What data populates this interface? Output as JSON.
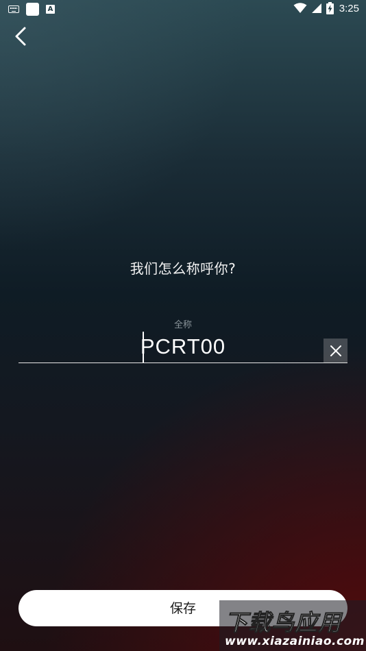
{
  "status_bar": {
    "time": "3:25",
    "icons": [
      "keyboard-icon",
      "notification-square-icon",
      "a-app-icon",
      "wifi-icon",
      "signal-icon",
      "battery-charging-icon"
    ],
    "a_icon_label": "A"
  },
  "nav": {
    "back_icon": "chevron-left-icon"
  },
  "prompt": {
    "title": "我们怎么称呼你?"
  },
  "name_field": {
    "label": "全称",
    "value": "PCRT00",
    "clear_icon": "close-icon"
  },
  "actions": {
    "save_label": "保存"
  },
  "watermark": {
    "brand": "下载鸟应用",
    "url": "www.xiazainiao.com"
  },
  "colors": {
    "background_top": "#2c4a53",
    "background_mid": "#0f1c25",
    "background_bottom": "#1f0f12",
    "text": "#ffffff",
    "label": "#8a949a",
    "button_bg": "#ffffff",
    "button_text": "#1a1a1a"
  }
}
